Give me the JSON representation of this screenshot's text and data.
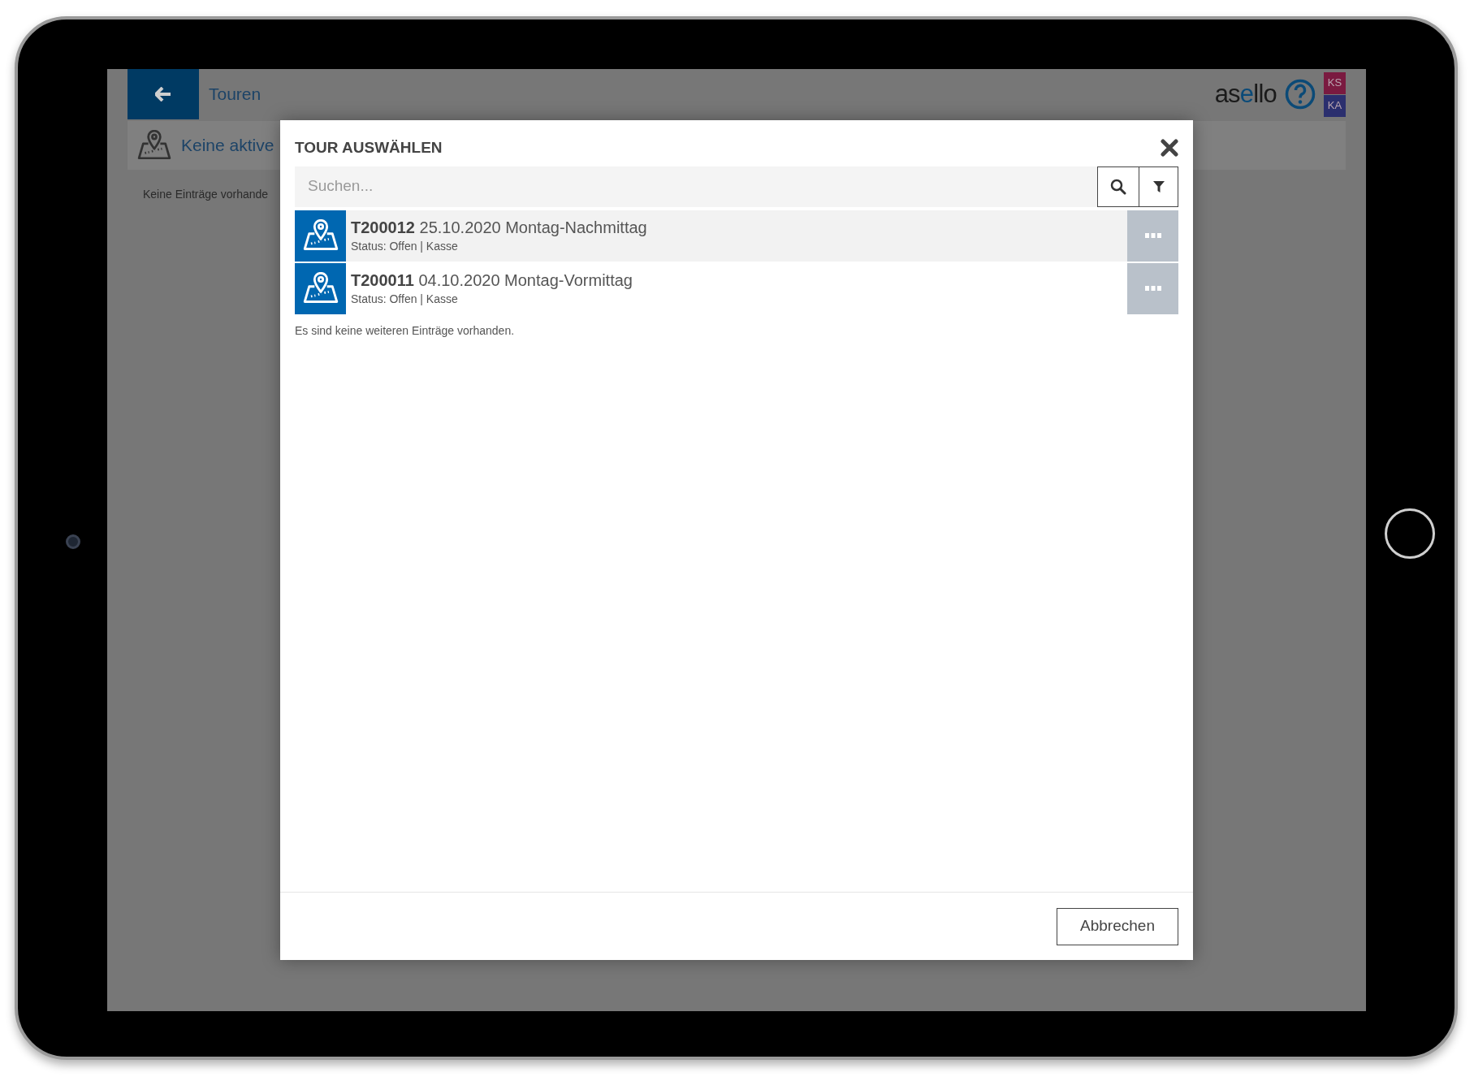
{
  "app": {
    "title": "Touren",
    "logo": [
      {
        "text": "as",
        "accent": false
      },
      {
        "text": "e",
        "accent": true
      },
      {
        "text": "llo",
        "accent": false
      }
    ],
    "user_badges": [
      {
        "text": "KS",
        "color": "#7a1a40"
      },
      {
        "text": "KA",
        "color": "#2b2f6e"
      }
    ],
    "banner": "Keine aktive",
    "empty_text": "Keine Einträge vorhande"
  },
  "dialog": {
    "title": "TOUR AUSWÄHLEN",
    "search": {
      "placeholder": "Suchen..."
    },
    "rows": [
      {
        "id": "T200012",
        "name": "25.10.2020 Montag-Nachmittag",
        "status": "Status: Offen | Kasse",
        "highlighted": true
      },
      {
        "id": "T200011",
        "name": "04.10.2020 Montag-Vormittag",
        "status": "Status: Offen | Kasse",
        "highlighted": false
      }
    ],
    "footer_note": "Es sind keine weiteren Einträge vorhanden.",
    "cancel_button": "Abbrechen"
  }
}
